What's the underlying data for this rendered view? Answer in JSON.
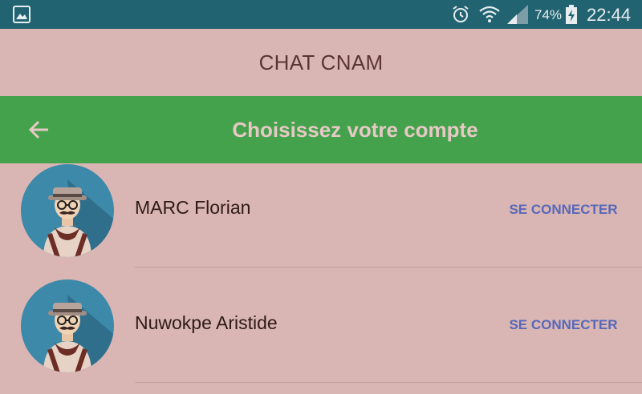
{
  "status_bar": {
    "battery_percent": "74%",
    "time": "22:44",
    "icons": [
      "gallery-icon",
      "alarm-icon",
      "wifi-icon",
      "signal-icon",
      "battery-charging-icon"
    ]
  },
  "app": {
    "title": "CHAT CNAM"
  },
  "toolbar": {
    "title": "Choisissez votre compte",
    "back_icon": "arrow-left-icon",
    "color": "#45a24c"
  },
  "accounts": [
    {
      "name": "MARC Florian",
      "action": "SE CONNECTER"
    },
    {
      "name": "Nuwokpe Aristide",
      "action": "SE CONNECTER"
    }
  ],
  "colors": {
    "status_bar": "#226371",
    "background": "#d9b6b3",
    "action_text": "#5868b8"
  }
}
